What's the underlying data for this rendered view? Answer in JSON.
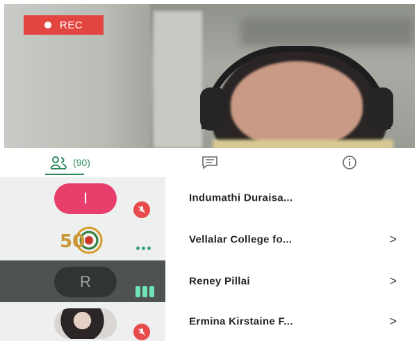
{
  "recording": {
    "label": "REC",
    "color": "#e34540"
  },
  "tabs": [
    {
      "id": "participants",
      "icon": "people-icon",
      "label": "(90)",
      "active": true
    },
    {
      "id": "chat",
      "icon": "chat-icon",
      "label": "",
      "active": false
    },
    {
      "id": "info",
      "icon": "info-icon",
      "label": "",
      "active": false
    }
  ],
  "participants": [
    {
      "name": "Indumathi Duraisa...",
      "avatar_type": "initial",
      "initial": "I",
      "status": "muted",
      "has_chevron": false
    },
    {
      "name": "Vellalar College fo...",
      "avatar_type": "logo",
      "logo_text": "50",
      "status": "more",
      "has_chevron": true,
      "chevron": ">"
    },
    {
      "name": "Reney Pillai",
      "avatar_type": "initial",
      "initial": "R",
      "status": "speaking",
      "has_chevron": true,
      "chevron": ">",
      "highlighted": true
    },
    {
      "name": "Ermina Kirstaine F...",
      "avatar_type": "photo",
      "status": "muted",
      "has_chevron": true,
      "chevron": ">"
    }
  ]
}
